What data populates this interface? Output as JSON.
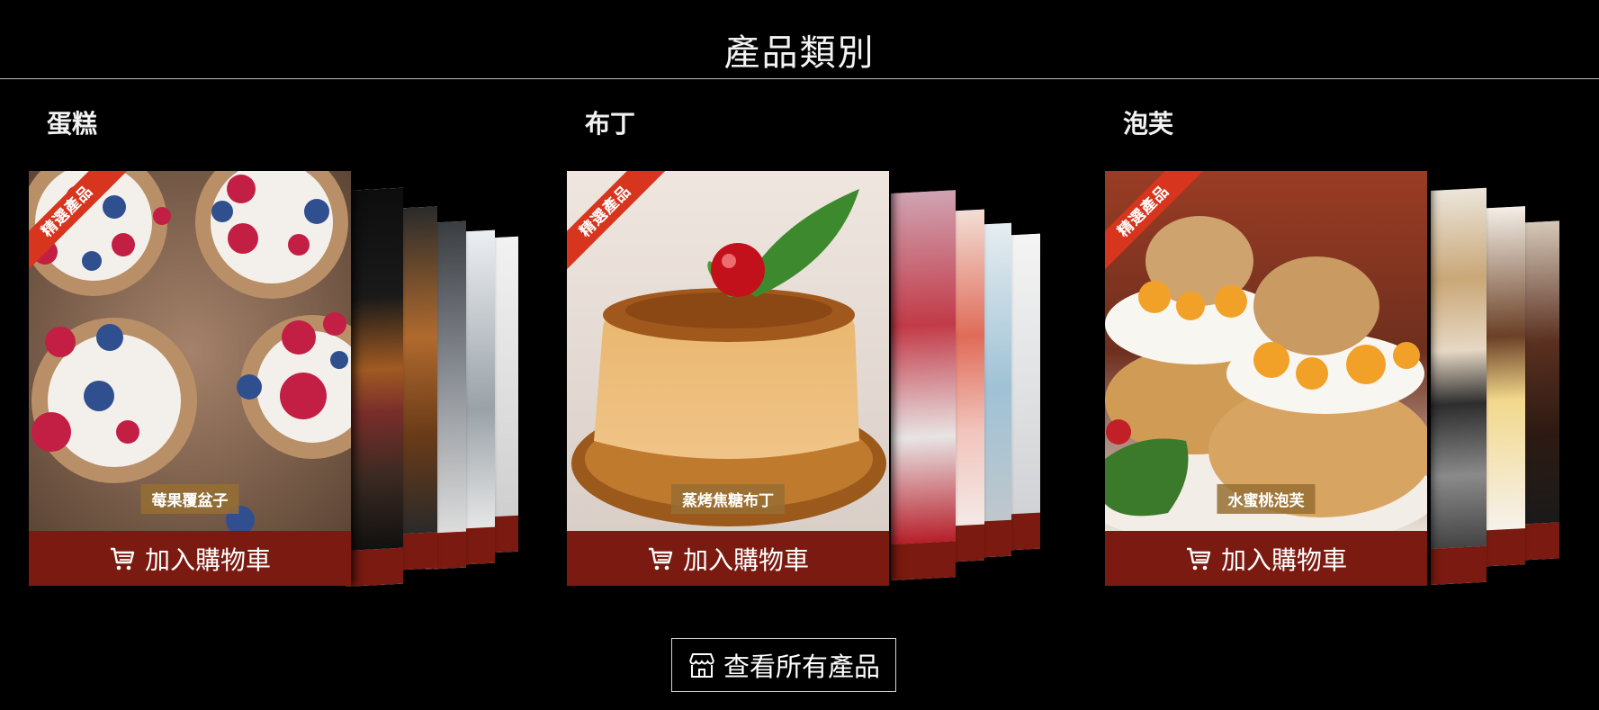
{
  "page": {
    "title": "產品類別"
  },
  "categories": [
    {
      "name": "蛋糕",
      "badge": "精選產品",
      "product": "莓果覆盆子",
      "cart_label": "加入購物車",
      "theme": "berry-tart"
    },
    {
      "name": "布丁",
      "badge": "精選產品",
      "product": "蒸烤焦糖布丁",
      "cart_label": "加入購物車",
      "theme": "caramel-pudding"
    },
    {
      "name": "泡芙",
      "badge": "精選產品",
      "product": "水蜜桃泡芙",
      "cart_label": "加入購物車",
      "theme": "peach-puff"
    }
  ],
  "view_all": {
    "label": "查看所有產品",
    "icon": "store-icon"
  },
  "colors": {
    "accent": "#7b1a10",
    "ribbon": "#d7351d",
    "background": "#000000"
  }
}
